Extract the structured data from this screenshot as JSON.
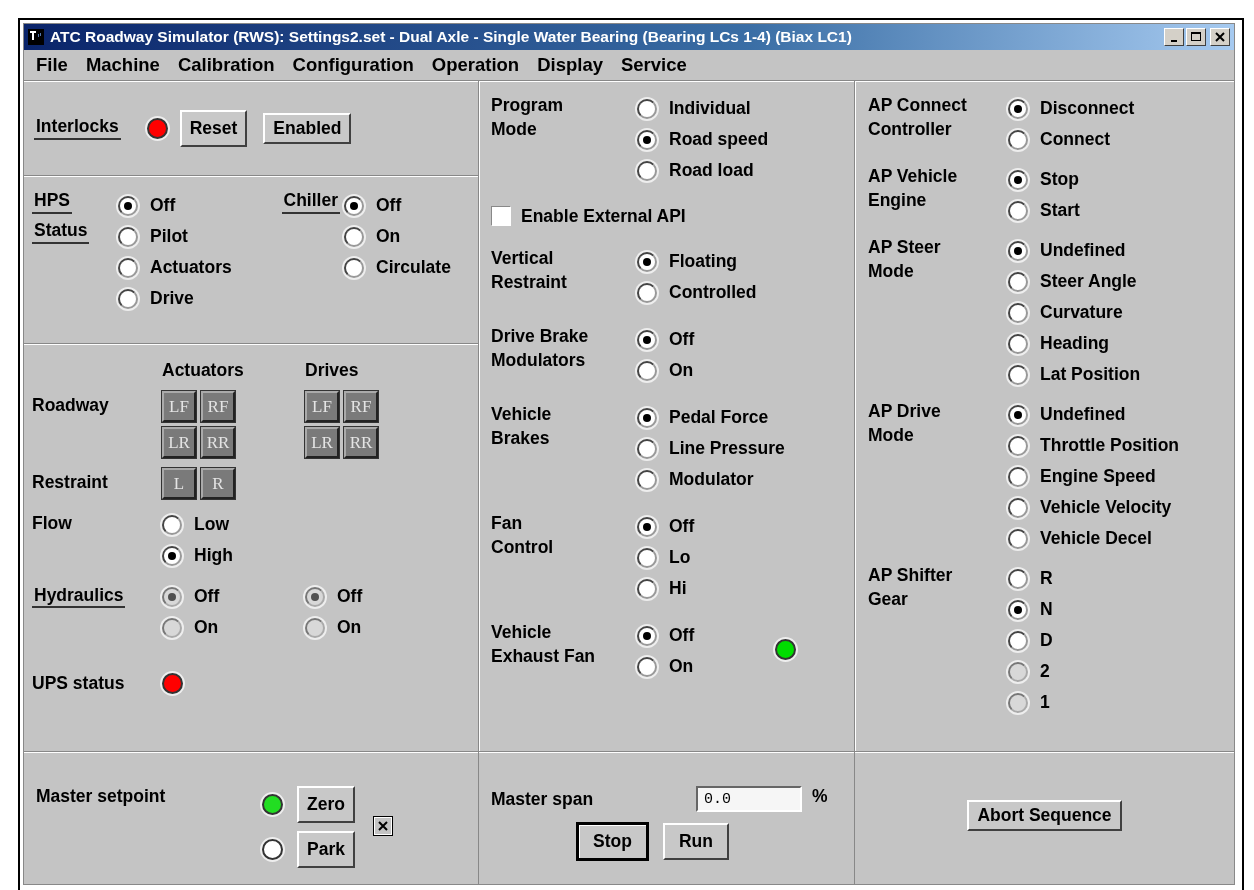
{
  "window": {
    "title": "ATC Roadway Simulator (RWS): Settings2.set - Dual Axle - Single Water Bearing (Bearing LCs 1-4) (Biax LC1)"
  },
  "menu": [
    "File",
    "Machine",
    "Calibration",
    "Configuration",
    "Operation",
    "Display",
    "Service"
  ],
  "interlocks": {
    "label": "Interlocks",
    "color": "#ff0000",
    "buttons": [
      "Reset",
      "Enabled"
    ]
  },
  "hps": {
    "labels": [
      "HPS",
      "Status"
    ],
    "options": [
      {
        "label": "Off",
        "selected": true,
        "disabled": false
      },
      {
        "label": "Pilot",
        "selected": false,
        "disabled": false
      },
      {
        "label": "Actuators",
        "selected": false,
        "disabled": false
      },
      {
        "label": "Drive",
        "selected": false,
        "disabled": false
      }
    ]
  },
  "chiller": {
    "label": "Chiller",
    "options": [
      {
        "label": "Off",
        "selected": true,
        "disabled": false
      },
      {
        "label": "On",
        "selected": false,
        "disabled": false
      },
      {
        "label": "Circulate",
        "selected": false,
        "disabled": false
      }
    ]
  },
  "roadway": {
    "headers": [
      "Actuators",
      "Drives"
    ],
    "label": "Roadway",
    "actuators": [
      "LF",
      "RF",
      "LR",
      "RR"
    ],
    "drives": [
      "LF",
      "RF",
      "LR",
      "RR"
    ]
  },
  "restraint": {
    "label": "Restraint",
    "buttons": [
      "L",
      "R"
    ]
  },
  "flow": {
    "label": "Flow",
    "options": [
      {
        "label": "Low",
        "selected": false,
        "disabled": false
      },
      {
        "label": "High",
        "selected": true,
        "disabled": false
      }
    ]
  },
  "hydraulics": {
    "label": "Hydraulics",
    "groups": [
      [
        {
          "label": "Off",
          "selected": true,
          "disabled": true
        },
        {
          "label": "On",
          "selected": false,
          "disabled": true
        }
      ],
      [
        {
          "label": "Off",
          "selected": true,
          "disabled": true
        },
        {
          "label": "On",
          "selected": false,
          "disabled": true
        }
      ]
    ]
  },
  "ups": {
    "label": "UPS status",
    "color": "#ff0000"
  },
  "middle": [
    {
      "kind": "radio",
      "label": "Program\nMode",
      "options": [
        {
          "label": "Individual",
          "selected": false,
          "disabled": false
        },
        {
          "label": "Road speed",
          "selected": true,
          "disabled": false
        },
        {
          "label": "Road load",
          "selected": false,
          "disabled": false
        }
      ]
    },
    {
      "kind": "checkbox",
      "label": "Enable External API",
      "checked": false
    },
    {
      "kind": "radio",
      "label": "Vertical\nRestraint",
      "options": [
        {
          "label": "Floating",
          "selected": true,
          "disabled": false
        },
        {
          "label": "Controlled",
          "selected": false,
          "disabled": false
        }
      ]
    },
    {
      "kind": "radio",
      "label": "Drive Brake\nModulators",
      "options": [
        {
          "label": "Off",
          "selected": true,
          "disabled": false
        },
        {
          "label": "On",
          "selected": false,
          "disabled": false
        }
      ]
    },
    {
      "kind": "radio",
      "label": "Vehicle\nBrakes",
      "options": [
        {
          "label": "Pedal Force",
          "selected": true,
          "disabled": false
        },
        {
          "label": "Line Pressure",
          "selected": false,
          "disabled": false
        },
        {
          "label": "Modulator",
          "selected": false,
          "disabled": false
        }
      ]
    },
    {
      "kind": "radio",
      "label": "Fan\nControl",
      "options": [
        {
          "label": "Off",
          "selected": true,
          "disabled": false
        },
        {
          "label": "Lo",
          "selected": false,
          "disabled": false
        },
        {
          "label": "Hi",
          "selected": false,
          "disabled": false
        }
      ]
    },
    {
      "kind": "radio",
      "label": "Vehicle\nExhaust Fan",
      "color": "#00dd00",
      "options": [
        {
          "label": "Off",
          "selected": true,
          "disabled": false
        },
        {
          "label": "On",
          "selected": false,
          "disabled": false
        }
      ]
    }
  ],
  "right": [
    {
      "label": "AP Connect\nController",
      "options": [
        {
          "label": "Disconnect",
          "selected": true,
          "disabled": false
        },
        {
          "label": "Connect",
          "selected": false,
          "disabled": false
        }
      ]
    },
    {
      "label": "AP Vehicle\nEngine",
      "options": [
        {
          "label": "Stop",
          "selected": true,
          "disabled": false
        },
        {
          "label": "Start",
          "selected": false,
          "disabled": false
        }
      ]
    },
    {
      "label": "AP Steer\nMode",
      "options": [
        {
          "label": "Undefined",
          "selected": true,
          "disabled": false
        },
        {
          "label": "Steer Angle",
          "selected": false,
          "disabled": false
        },
        {
          "label": "Curvature",
          "selected": false,
          "disabled": false
        },
        {
          "label": "Heading",
          "selected": false,
          "disabled": false
        },
        {
          "label": "Lat Position",
          "selected": false,
          "disabled": false
        }
      ]
    },
    {
      "label": "AP Drive\nMode",
      "options": [
        {
          "label": "Undefined",
          "selected": true,
          "disabled": false
        },
        {
          "label": "Throttle Position",
          "selected": false,
          "disabled": false
        },
        {
          "label": "Engine Speed",
          "selected": false,
          "disabled": false
        },
        {
          "label": "Vehicle Velocity",
          "selected": false,
          "disabled": false
        },
        {
          "label": "Vehicle Decel",
          "selected": false,
          "disabled": false
        }
      ]
    },
    {
      "label": "AP Shifter\nGear",
      "options": [
        {
          "label": "R",
          "selected": false,
          "disabled": false
        },
        {
          "label": "N",
          "selected": true,
          "disabled": false
        },
        {
          "label": "D",
          "selected": false,
          "disabled": false
        },
        {
          "label": "2",
          "selected": false,
          "disabled": true
        },
        {
          "label": "1",
          "selected": false,
          "disabled": true
        }
      ]
    }
  ],
  "master_setpoint": {
    "label": "Master setpoint",
    "rows": [
      {
        "color": "#22dd22",
        "button": "Zero"
      },
      {
        "color": "#ffffff",
        "button": "Park"
      }
    ]
  },
  "master_span": {
    "label": "Master span",
    "value": "0.0",
    "unit": "%",
    "buttons": [
      "Stop",
      "Run"
    ]
  },
  "abort": {
    "label": "Abort Sequence"
  }
}
